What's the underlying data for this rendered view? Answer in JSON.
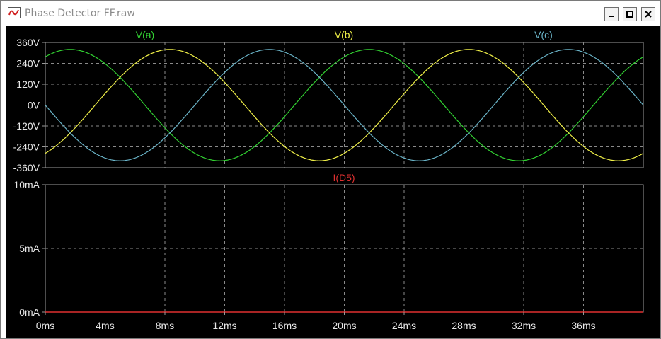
{
  "window": {
    "title": "Phase Detector FF.raw",
    "minimize_icon": "minimize-icon",
    "maximize_icon": "maximize-icon",
    "close_icon": "close-icon",
    "app_icon": "waveform-app-icon"
  },
  "colors": {
    "background": "#000000",
    "axis": "#9a9a9a",
    "grid": "#8a8a8a",
    "text": "#e8e8e8",
    "va": "#32d232",
    "vb": "#f0f048",
    "vc": "#6ab4c8",
    "id5": "#e03030"
  },
  "chart_data": [
    {
      "type": "line",
      "title": "",
      "xlabel": "",
      "ylabel": "",
      "xlim": [
        0,
        40
      ],
      "ylim": [
        -360,
        360
      ],
      "x_unit": "ms",
      "xticks": [
        "0ms",
        "4ms",
        "8ms",
        "12ms",
        "16ms",
        "20ms",
        "24ms",
        "28ms",
        "32ms",
        "36ms"
      ],
      "yticks": [
        "360V",
        "240V",
        "120V",
        "0V",
        "-120V",
        "-240V",
        "-360V"
      ],
      "grid": true,
      "legend": "top",
      "series": [
        {
          "name": "V(a)",
          "amplitude": 320,
          "frequency_hz": 50,
          "phase_deg": 60,
          "color": "#32d232"
        },
        {
          "name": "V(b)",
          "amplitude": 320,
          "frequency_hz": 50,
          "phase_deg": -60,
          "color": "#f0f048"
        },
        {
          "name": "V(c)",
          "amplitude": 320,
          "frequency_hz": 50,
          "phase_deg": 180,
          "color": "#6ab4c8"
        }
      ]
    },
    {
      "type": "line",
      "title": "",
      "xlabel": "",
      "ylabel": "",
      "xlim": [
        0,
        40
      ],
      "ylim": [
        0,
        10
      ],
      "x_unit": "ms",
      "xticks": [
        "0ms",
        "4ms",
        "8ms",
        "12ms",
        "16ms",
        "20ms",
        "24ms",
        "28ms",
        "32ms",
        "36ms"
      ],
      "yticks": [
        "10mA",
        "5mA",
        "0mA"
      ],
      "grid": true,
      "legend": "top",
      "series": [
        {
          "name": "I(D5)",
          "x": [
            0,
            40
          ],
          "values": [
            0,
            0
          ],
          "color": "#e03030"
        }
      ]
    }
  ]
}
